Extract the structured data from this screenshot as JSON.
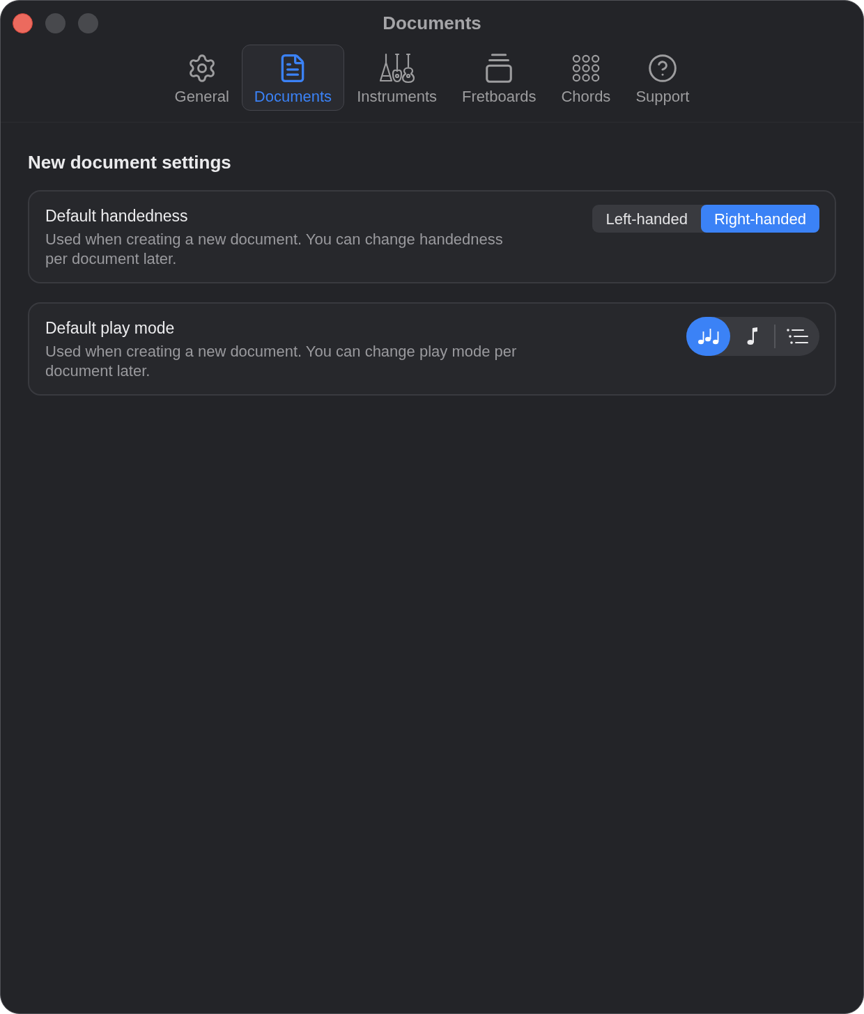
{
  "window": {
    "title": "Documents"
  },
  "toolbar": {
    "tabs": [
      {
        "label": "General",
        "selected": false
      },
      {
        "label": "Documents",
        "selected": true
      },
      {
        "label": "Instruments",
        "selected": false
      },
      {
        "label": "Fretboards",
        "selected": false
      },
      {
        "label": "Chords",
        "selected": false
      },
      {
        "label": "Support",
        "selected": false
      }
    ]
  },
  "section": {
    "title": "New document settings"
  },
  "settings": [
    {
      "kind": "segmented",
      "title": "Default handedness",
      "description": "Used when creating a new document. You can change handedness per document later.",
      "options": [
        {
          "label": "Left-handed",
          "selected": false
        },
        {
          "label": "Right-handed",
          "selected": true
        }
      ]
    },
    {
      "kind": "icon_segmented",
      "title": "Default play mode",
      "description": "Used when creating a new document. You can change play mode per document later.",
      "options": [
        {
          "selected": true
        },
        {
          "selected": false
        },
        {
          "selected": false
        }
      ]
    }
  ]
}
